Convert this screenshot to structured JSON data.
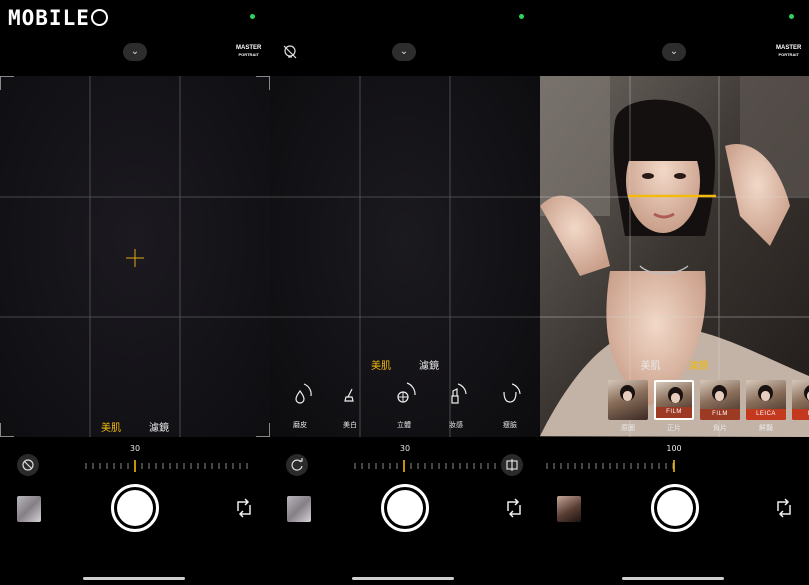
{
  "logo": {
    "text": "MOBILE",
    "mark": "01"
  },
  "panels": {
    "p1": {
      "top": {
        "master_line1": "MASTER",
        "master_line2": "PORTRAIT"
      },
      "modes": [
        {
          "label": "美肌",
          "active": true
        },
        {
          "label": "濾鏡",
          "active": false
        }
      ],
      "dial": {
        "value": "30"
      }
    },
    "p2": {
      "modes": [
        {
          "label": "美肌",
          "active": true
        },
        {
          "label": "濾鏡",
          "active": false
        }
      ],
      "tools": [
        {
          "label": "磨皮",
          "icon": "drop-icon"
        },
        {
          "label": "美白",
          "icon": "brush-icon"
        },
        {
          "label": "立體",
          "icon": "contour-icon"
        },
        {
          "label": "妝感",
          "icon": "lipstick-icon"
        },
        {
          "label": "瘦臉",
          "icon": "face-slim-icon"
        }
      ],
      "dial": {
        "value": "30"
      }
    },
    "p3": {
      "top": {
        "master_line1": "MASTER",
        "master_line2": "PORTRAIT"
      },
      "modes": [
        {
          "label": "美肌",
          "active": false
        },
        {
          "label": "濾鏡",
          "active": true
        }
      ],
      "filters": [
        {
          "label": "原圖",
          "tag": ""
        },
        {
          "label": "正片",
          "tag": "FILM"
        },
        {
          "label": "負片",
          "tag": "FILM"
        },
        {
          "label": "鮮豔",
          "tag": "LEICA"
        },
        {
          "label": "自",
          "tag": "LE"
        }
      ],
      "dial": {
        "value": "100"
      }
    }
  },
  "colors": {
    "accent": "#f2b90f",
    "status_dot": "#2fd35a",
    "leica_red": "#c4381e"
  }
}
